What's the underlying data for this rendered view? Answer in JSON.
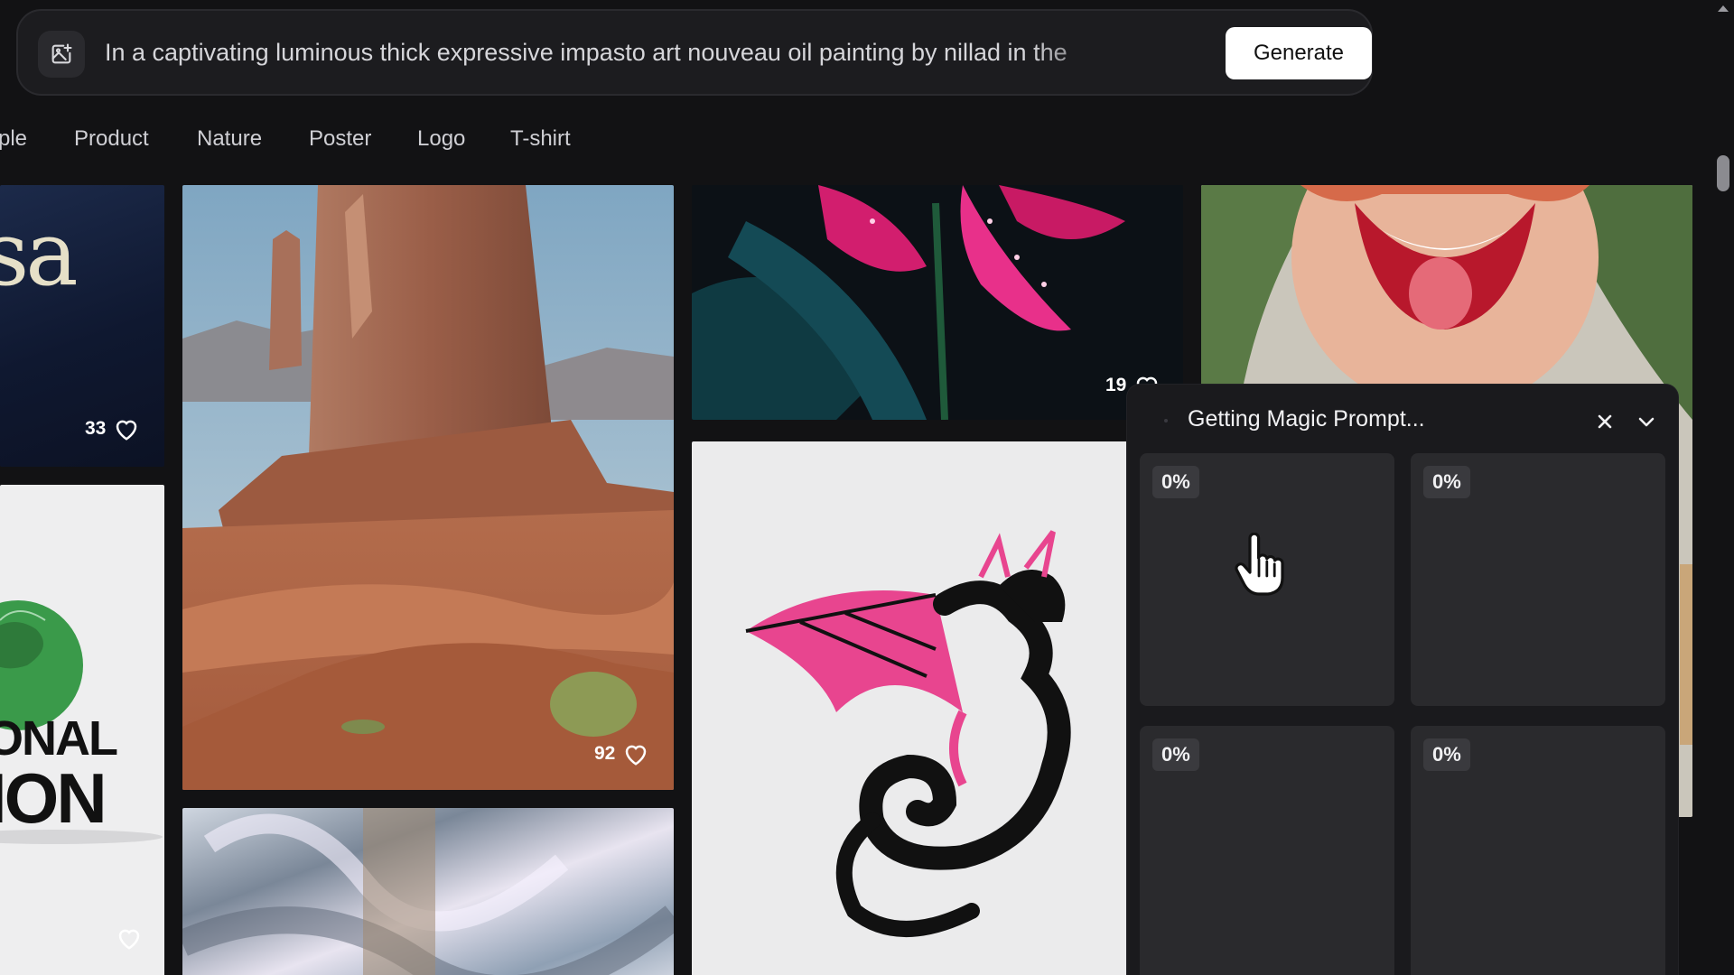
{
  "prompt": {
    "text": "In a captivating luminous thick expressive impasto art nouveau oil painting by nillad in the",
    "icon": "image-plus-icon",
    "generate_label": "Generate"
  },
  "tabs": [
    "ple",
    "Product",
    "Nature",
    "Poster",
    "Logo",
    "T-shirt"
  ],
  "gallery": {
    "tile_1_likes": "33",
    "tile_2_likes": "92",
    "tile_3_likes": "19",
    "tile_1_text": "sa",
    "tile_4_text_line1": "ONAL",
    "tile_4_text_line2": "ION"
  },
  "magic_panel": {
    "title": "Getting Magic Prompt...",
    "cells": [
      {
        "progress": "0%"
      },
      {
        "progress": "0%"
      },
      {
        "progress": "0%"
      },
      {
        "progress": "0%"
      }
    ]
  },
  "colors": {
    "background": "#121214",
    "panel": "#1a1a1d",
    "cell": "#2a2a2d",
    "accent_pink": "#e3468f"
  }
}
